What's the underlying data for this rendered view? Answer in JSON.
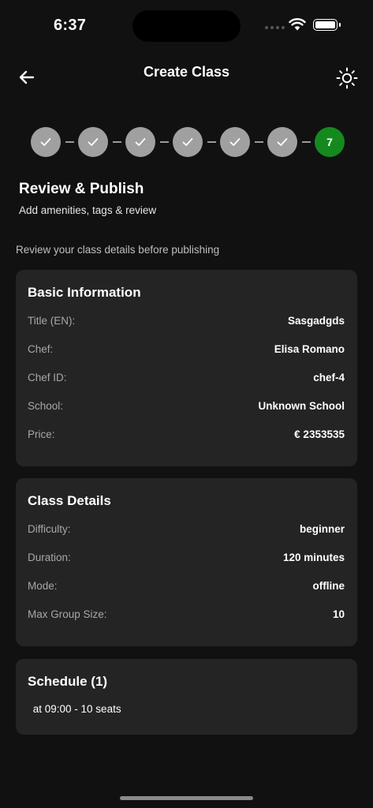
{
  "status_bar": {
    "time": "6:37"
  },
  "nav": {
    "title": "Create Class",
    "back_icon": "arrow-left-icon",
    "theme_icon": "sun-icon"
  },
  "stepper": {
    "completed_steps": [
      1,
      2,
      3,
      4,
      5,
      6
    ],
    "current_step": "7",
    "completed_color": "#a0a0a0",
    "active_color": "#148a1e"
  },
  "header": {
    "title": "Review & Publish",
    "subtitle": "Add amenities, tags & review"
  },
  "review_note": "Review your class details before publishing",
  "basic_info": {
    "title": "Basic Information",
    "rows": [
      {
        "label": "Title (EN):",
        "value": "Sasgadgds"
      },
      {
        "label": "Chef:",
        "value": "Elisa Romano"
      },
      {
        "label": "Chef ID:",
        "value": "chef-4"
      },
      {
        "label": "School:",
        "value": "Unknown School"
      },
      {
        "label": "Price:",
        "value": "€ 2353535"
      }
    ]
  },
  "class_details": {
    "title": "Class Details",
    "rows": [
      {
        "label": "Difficulty:",
        "value": "beginner"
      },
      {
        "label": "Duration:",
        "value": "120 minutes"
      },
      {
        "label": "Mode:",
        "value": "offline"
      },
      {
        "label": "Max Group Size:",
        "value": "10"
      }
    ]
  },
  "schedule": {
    "title": "Schedule (1)",
    "items": [
      " at 09:00 - 10 seats"
    ]
  }
}
